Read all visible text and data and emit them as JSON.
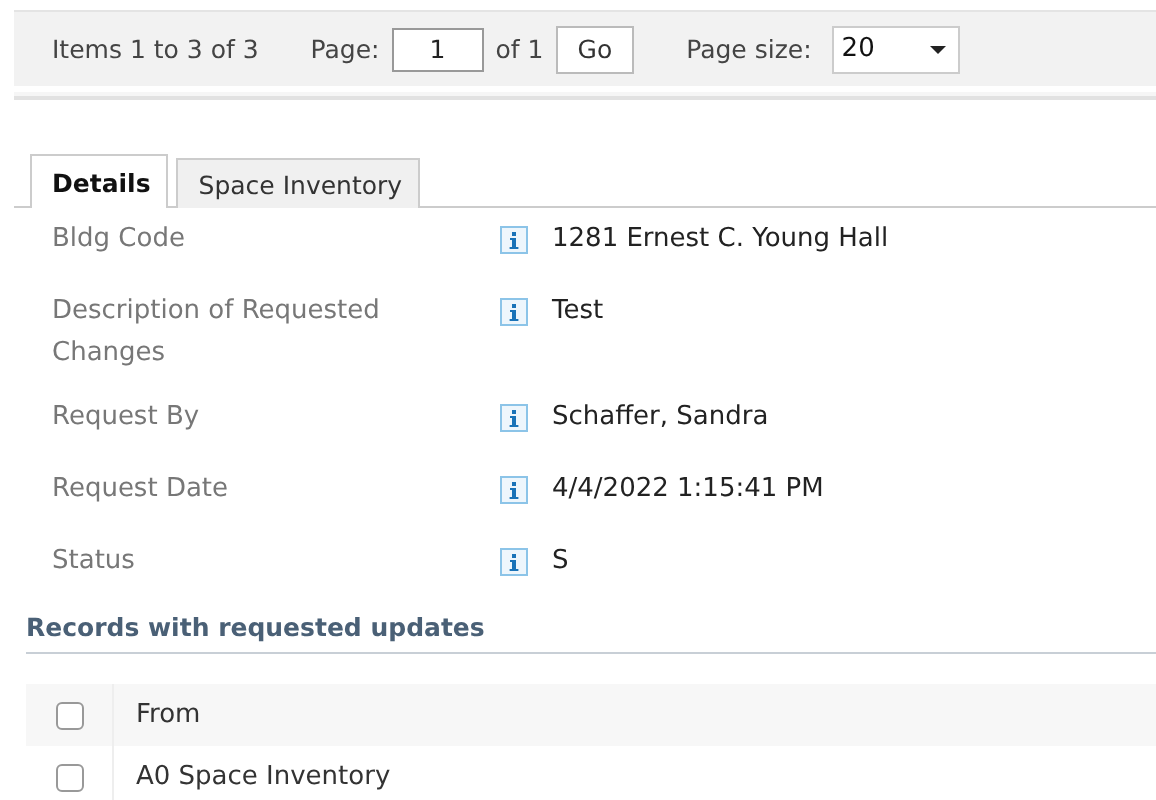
{
  "pager": {
    "summary": "Items 1 to 3 of 3",
    "page_label": "Page:",
    "page_value": "1",
    "page_total": "of 1",
    "go_button": "Go",
    "page_size_label": "Page size:",
    "page_size_value": "20"
  },
  "tabs": [
    {
      "label": "Details",
      "selected": true
    },
    {
      "label": "Space Inventory",
      "selected": false
    }
  ],
  "details": [
    {
      "label": "Bldg Code",
      "value": "1281 Ernest C. Young Hall"
    },
    {
      "label": "Description of Requested Changes",
      "value": "Test"
    },
    {
      "label": "Request By",
      "value": "Schaffer, Sandra"
    },
    {
      "label": "Request Date",
      "value": "4/4/2022 1:15:41 PM"
    },
    {
      "label": "Status",
      "value": "S"
    }
  ],
  "records": {
    "title": "Records with requested updates",
    "header": {
      "label": "From",
      "checked": false
    },
    "rows": [
      {
        "label": "A0 Space Inventory",
        "checked": false
      }
    ]
  }
}
